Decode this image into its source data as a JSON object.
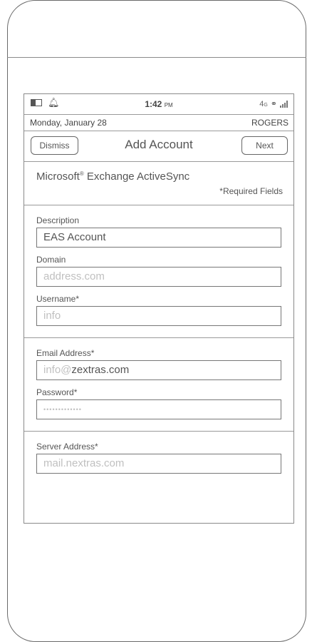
{
  "status_bar": {
    "time": "1:42",
    "meridiem": "PM",
    "network": "4",
    "network_sub": "G",
    "icons": [
      "battery-icon",
      "bell-icon",
      "sync-icon",
      "signal-icon"
    ]
  },
  "date_bar": {
    "date": "Monday, January 28",
    "carrier": "ROGERS"
  },
  "header": {
    "dismiss_label": "Dismiss",
    "title": "Add Account",
    "next_label": "Next"
  },
  "account_type": {
    "name_pre": "Microsoft",
    "registered": "®",
    "name_post": " Exchange ActiveSync",
    "required_note": "*Required Fields"
  },
  "fields": {
    "description": {
      "label": "Description",
      "value": "EAS Account"
    },
    "domain": {
      "label": "Domain",
      "placeholder": "address.com"
    },
    "username": {
      "label": "Username*",
      "placeholder": "info"
    },
    "email": {
      "label": "Email Address*",
      "value_light": "info@",
      "value_strong": "zextras.com"
    },
    "password": {
      "label": "Password*",
      "value": "•••••••••••••"
    },
    "server": {
      "label": "Server Address*",
      "placeholder": "mail.nextras.com"
    }
  }
}
